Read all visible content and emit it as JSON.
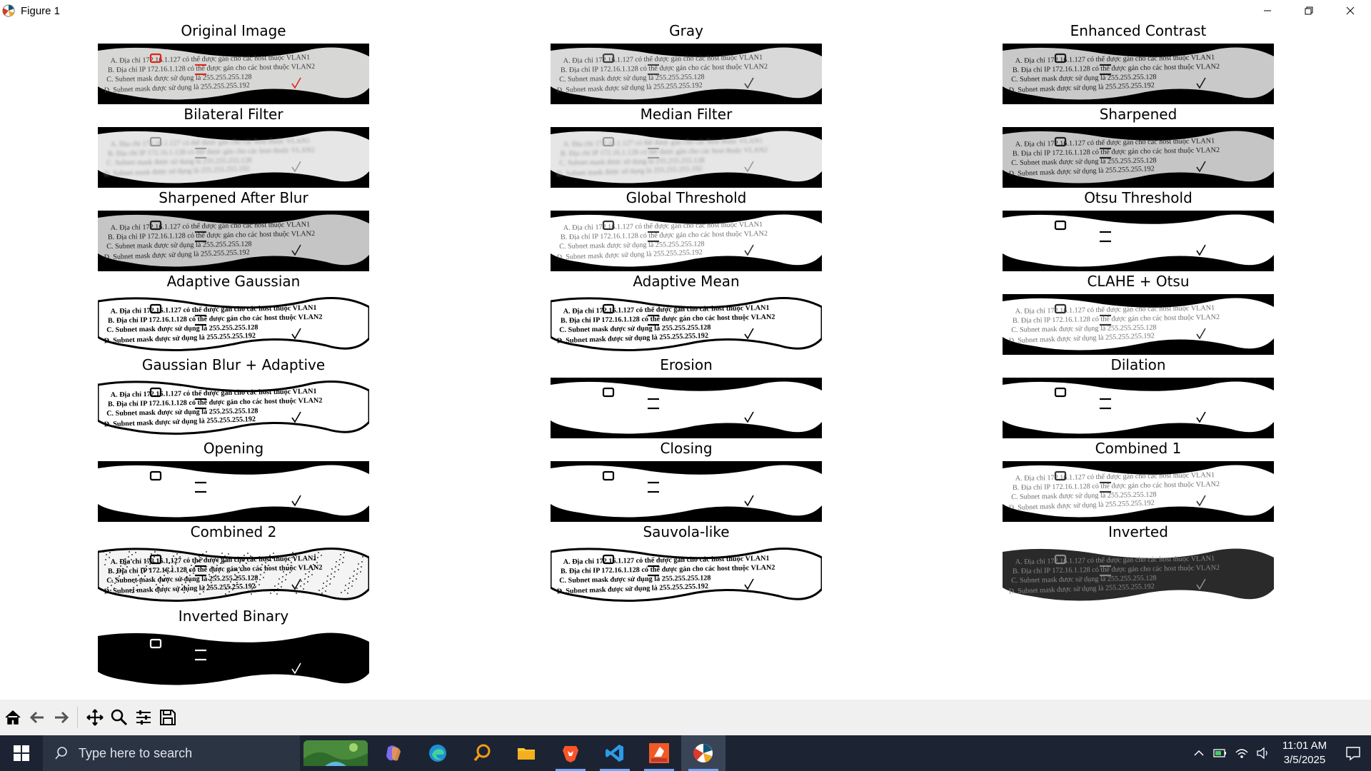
{
  "window": {
    "title": "Figure 1",
    "app_icon": "matplotlib-icon",
    "controls": [
      "minimize-icon",
      "restore-icon",
      "close-icon"
    ]
  },
  "panels": [
    {
      "title": "Original Image",
      "style": "original"
    },
    {
      "title": "Gray",
      "style": "gray"
    },
    {
      "title": "Enhanced Contrast",
      "style": "contrast"
    },
    {
      "title": "Bilateral Filter",
      "style": "blur"
    },
    {
      "title": "Median Filter",
      "style": "blur"
    },
    {
      "title": "Sharpened",
      "style": "sharp"
    },
    {
      "title": "Sharpened After Blur",
      "style": "sharp"
    },
    {
      "title": "Global Threshold",
      "style": "threshold"
    },
    {
      "title": "Otsu Threshold",
      "style": "mask"
    },
    {
      "title": "Adaptive Gaussian",
      "style": "adaptive"
    },
    {
      "title": "Adaptive Mean",
      "style": "adaptive"
    },
    {
      "title": "CLAHE + Otsu",
      "style": "threshold"
    },
    {
      "title": "Gaussian Blur + Adaptive",
      "style": "adaptive"
    },
    {
      "title": "Erosion",
      "style": "mask"
    },
    {
      "title": "Dilation",
      "style": "mask"
    },
    {
      "title": "Opening",
      "style": "mask"
    },
    {
      "title": "Closing",
      "style": "mask"
    },
    {
      "title": "Combined 1",
      "style": "threshold"
    },
    {
      "title": "Combined 2",
      "style": "noisy"
    },
    {
      "title": "Sauvola-like",
      "style": "adaptive"
    },
    {
      "title": "Inverted",
      "style": "inverted"
    },
    {
      "title": "Inverted Binary",
      "style": "invbinary"
    }
  ],
  "image_text": {
    "line1": "A. Địa chỉ 172.16.1.127 có thể được gán cho các host thuộc VLAN1",
    "line2": "B. Địa chỉ IP 172.16.1.128 có thể được gán cho các host thuộc VLAN2",
    "line3": "C. Subnet mask được sử dụng là 255.255.255.128",
    "line4": "D. Subnet mask được sử dụng là 255.255.255.192"
  },
  "toolbar": {
    "buttons": [
      "home-icon",
      "back-icon",
      "forward-icon",
      "pan-icon",
      "zoom-icon",
      "configure-subplots-icon",
      "save-icon"
    ]
  },
  "taskbar": {
    "search_placeholder": "Type here to search",
    "apps": [
      "copilot-icon",
      "edge-icon",
      "search-app-icon",
      "file-explorer-icon",
      "brave-icon",
      "vscode-icon",
      "foxit-reader-icon",
      "matplotlib-figure-icon"
    ],
    "time": "11:01 AM",
    "date": "3/5/2025"
  },
  "colors": {
    "taskbar_bg": "#1c2433",
    "toolbar_bg": "#f0f0f0",
    "accent_red": "#e0251b",
    "active_underline": "#6fa8ff"
  }
}
